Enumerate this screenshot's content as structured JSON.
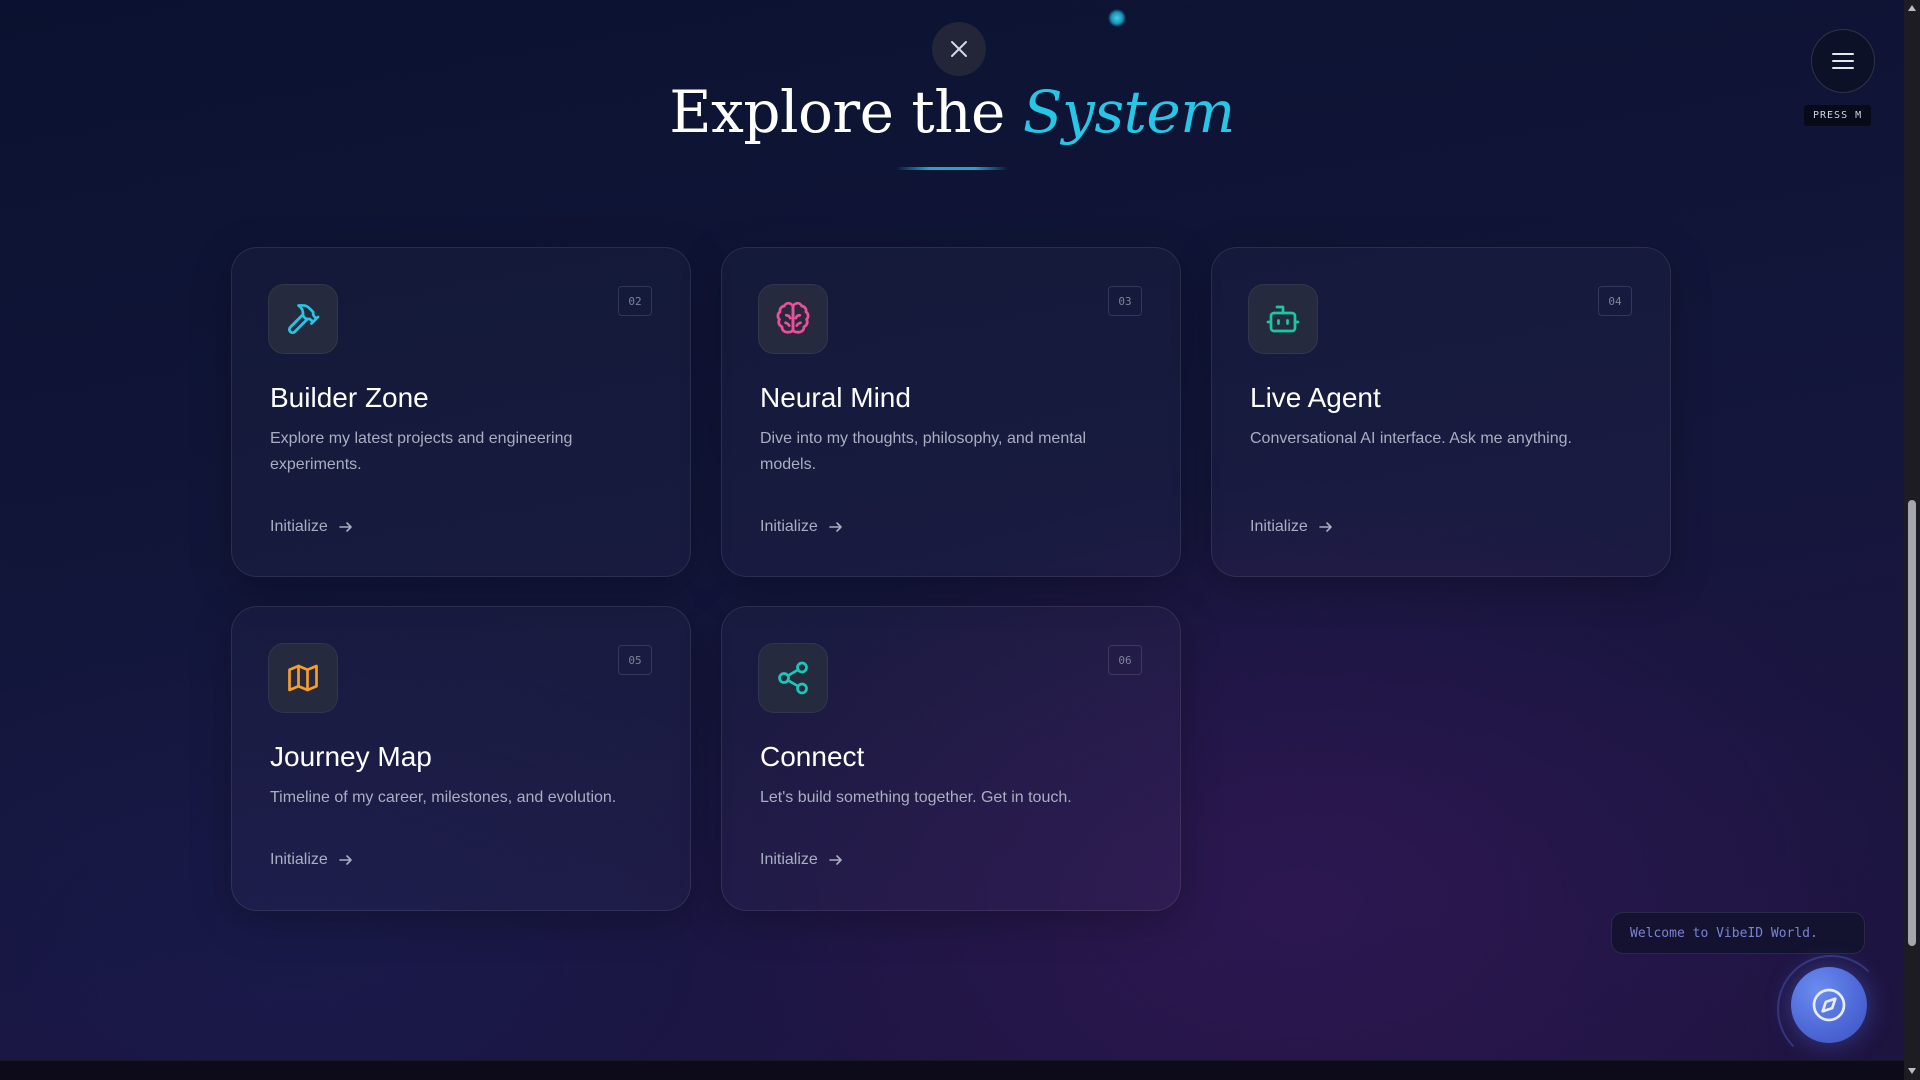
{
  "header": {
    "title_prefix": "Explore the ",
    "title_accent": "System",
    "close_icon": "close-icon",
    "menu_icon": "hamburger-menu-icon",
    "menu_hint": "PRESS M",
    "accent_color": "#27c6e6"
  },
  "cards": [
    {
      "number": "02",
      "title": "Builder Zone",
      "description": "Explore my latest projects and engineering experiments.",
      "link_label": "Initialize",
      "icon": "hammer-icon",
      "icon_color": "#27c6e6"
    },
    {
      "number": "03",
      "title": "Neural Mind",
      "description": "Dive into my thoughts, philosophy, and mental models.",
      "link_label": "Initialize",
      "icon": "brain-icon",
      "icon_color": "#ec4f9c"
    },
    {
      "number": "04",
      "title": "Live Agent",
      "description": "Conversational AI interface. Ask me anything.",
      "link_label": "Initialize",
      "icon": "robot-icon",
      "icon_color": "#19c9a2"
    },
    {
      "number": "05",
      "title": "Journey Map",
      "description": "Timeline of my career, milestones, and evolution.",
      "link_label": "Initialize",
      "icon": "map-icon",
      "icon_color": "#f59e2b"
    },
    {
      "number": "06",
      "title": "Connect",
      "description": "Let's build something together. Get in touch.",
      "link_label": "Initialize",
      "icon": "share-icon",
      "icon_color": "#19c9b8"
    }
  ],
  "assistant": {
    "welcome_text": "Welcome to VibeID World.",
    "button_icon": "compass-icon"
  }
}
